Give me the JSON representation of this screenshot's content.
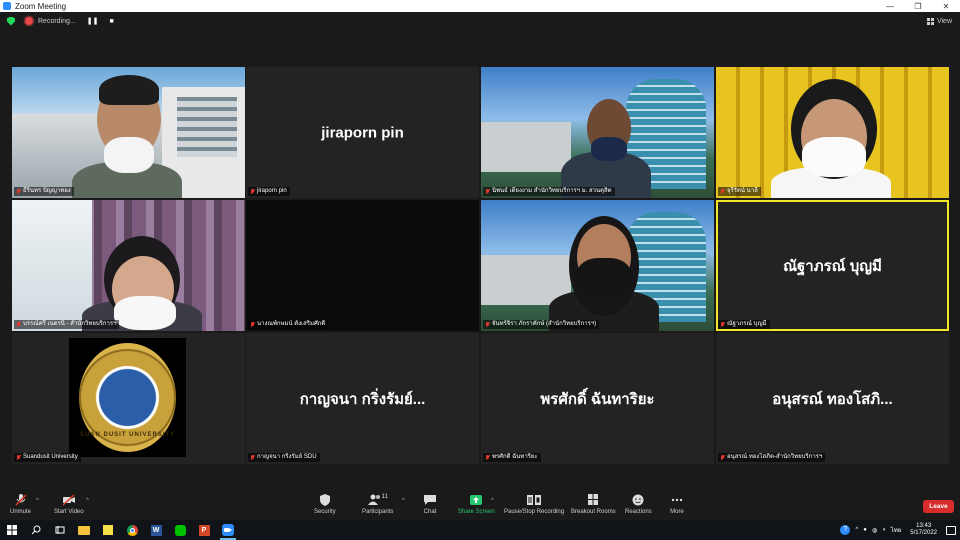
{
  "window": {
    "title": "Zoom Meeting",
    "controls": [
      "—",
      "❐",
      "✕"
    ]
  },
  "topbar": {
    "recording_label": "Recording...",
    "pause_symbol": "❚❚",
    "stop_symbol": "■",
    "view_label": "View"
  },
  "participants": [
    {
      "name": "ธีรินทร ปัญญาทอง",
      "display": "",
      "video": "building"
    },
    {
      "name": "jiraporn pin",
      "display": "jiraporn pin",
      "video": "none"
    },
    {
      "name": "นิพนธ์ เตียงงาม สำนักวิทยบริการฯ ม. สวนดุสิต",
      "display": "",
      "video": "campus"
    },
    {
      "name": "จุรีรัตน์ นาลี",
      "display": "",
      "video": "shelf"
    },
    {
      "name": "บรรณ์ศรี เนตรนิ - สำนักวิทยบริการฯ",
      "display": "",
      "video": "curtain"
    },
    {
      "name": "นางณพ์กษมน์ ตั้งเสริมศักดิ์",
      "display": "",
      "video": "dark"
    },
    {
      "name": "จันทร์จิรา ภักราคักษ์ (สำนักวิทยบริการฯ)",
      "display": "",
      "video": "campus"
    },
    {
      "name": "ณัฐาภรณ์ บุญมี",
      "display": "ณัฐาภรณ์ บุญมี",
      "video": "none",
      "active_speaker": true
    },
    {
      "name": "Suandusit University",
      "display": "",
      "video": "logo",
      "logo_text": "SUAN DUSIT UNIVERSITY"
    },
    {
      "name": "กาญจนา กริ่งรัมย์ SDU",
      "display": "กาญจนา กริ่งรัมย์...",
      "video": "none"
    },
    {
      "name": "พรศักดิ์ ฉันทาริยะ",
      "display": "พรศักดิ์ ฉันทาริยะ",
      "video": "none"
    },
    {
      "name": "อนุสรณ์ ทองโสภิต-สำนักวิทยบริการฯ",
      "display": "อนุสรณ์ ทองโสภิ...",
      "video": "none"
    }
  ],
  "toolbar": {
    "unmute": "Unmute",
    "start_video": "Start Video",
    "security": "Security",
    "participants": "Participants",
    "participant_count": "11",
    "chat": "Chat",
    "share_screen": "Share Screen",
    "pause_stop_recording": "Pause/Stop Recording",
    "breakout_rooms": "Breakout Rooms",
    "reactions": "Reactions",
    "more": "More",
    "leave": "Leave",
    "caret": "^"
  },
  "taskbar": {
    "time": "13:43",
    "date": "5/17/2022",
    "language": "ไทย"
  },
  "colors": {
    "active_speaker_border": "#f0e62a",
    "share_green": "#28c76f",
    "leave_red": "#d92c2c",
    "muted_red": "#e0392b",
    "security_green": "#23d959"
  }
}
